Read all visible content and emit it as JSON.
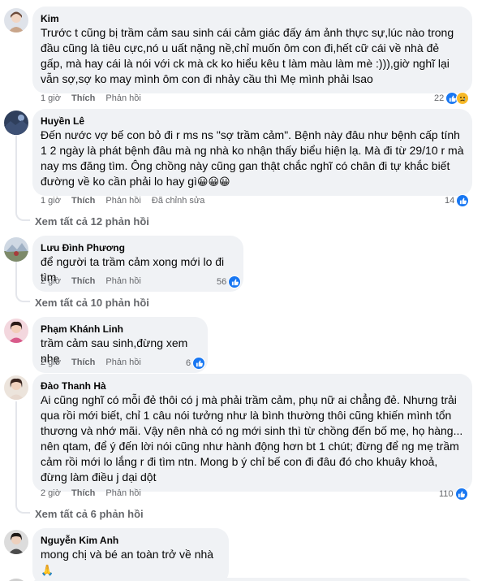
{
  "comments": [
    {
      "author": "Kim",
      "text": "Trước t cũng bị trầm cảm sau sinh cái cảm giác đấy ám ảnh thực sự,lúc nào trong đầu cũng là tiêu cực,nó u uất nặng nề,chỉ muốn ôm con đi,hết cữ cái về nhà đẻ gấp, mà hay cái là nói với ck mà ck ko hiểu kêu t làm màu làm mè :))),giờ nghĩ lại vẫn sợ,sợ ko may mình ôm con đi nhảy cầu thì Mẹ mình phải lsao",
      "time": "1 giờ",
      "like": "Thích",
      "reply": "Phản hồi",
      "reactions": "22",
      "reaction_icons": [
        "like-icon",
        "sad-icon"
      ]
    },
    {
      "author": "Huyền Lê",
      "text": "Đến nước vợ bế con bỏ đi r ms ns \"sợ trầm cảm\". Bệnh này đâu như bệnh cấp tính 1 2 ngày là phát bệnh đâu mà ng nhà ko nhận thấy biểu hiện lạ. Mà đi từ 29/10 r mà nay ms đăng tìm. Ông chồng này cũng gan thật chắc nghĩ có chân đi tự khắc biết đường về ko cần phải lo hay gì",
      "emojis": "😀😀😀",
      "time": "1 giờ",
      "like": "Thích",
      "reply": "Phản hồi",
      "edited": "Đã chỉnh sửa",
      "reactions": "14",
      "see_all": "Xem tất cả 12 phản hồi"
    },
    {
      "author": "Lưu Đình Phương",
      "text": "để người ta trầm cảm xong mới lo đi tìm",
      "time": "2 giờ",
      "like": "Thích",
      "reply": "Phản hồi",
      "reactions": "56",
      "see_all": "Xem tất cả 10 phản hồi"
    },
    {
      "author": "Phạm Khánh Linh",
      "text": "trầm cảm sau sinh,đừng xem nhẹ",
      "time": "2 giờ",
      "like": "Thích",
      "reply": "Phản hồi",
      "reactions": "6"
    },
    {
      "author": "Đào Thanh Hà",
      "text": "Ai cũng nghĩ có mỗi đẻ thôi có j mà phải trầm cảm, phụ nữ ai chẳng đẻ. Nhưng trải qua rồi mới biết, chỉ 1 câu nói tưởng như là bình thường thôi cũng khiến mình tổn thương và nhớ mãi. Vậy nên nhà có ng mới sinh thì từ chồng đến bố mẹ, họ hàng... nên qtam, để ý đến lời nói cũng như hành động hơn bt 1 chút; đừng để ng mẹ trầm cảm rồi mới lo lắng r đi tìm ntn. Mong b ý chỉ bế con đi đâu đó cho khuây khoả, đừng làm điều j dại dột",
      "time": "2 giờ",
      "like": "Thích",
      "reply": "Phản hồi",
      "reactions": "110",
      "see_all": "Xem tất cả 6 phản hồi"
    },
    {
      "author": "Nguyễn Kim Anh",
      "text": "mong chị và bé an toàn trở về nhà",
      "emojis": "🙏"
    }
  ],
  "colors": {
    "bubble": "#f0f2f5",
    "like_blue": "#1877f2",
    "meta_gray": "#65676b"
  }
}
